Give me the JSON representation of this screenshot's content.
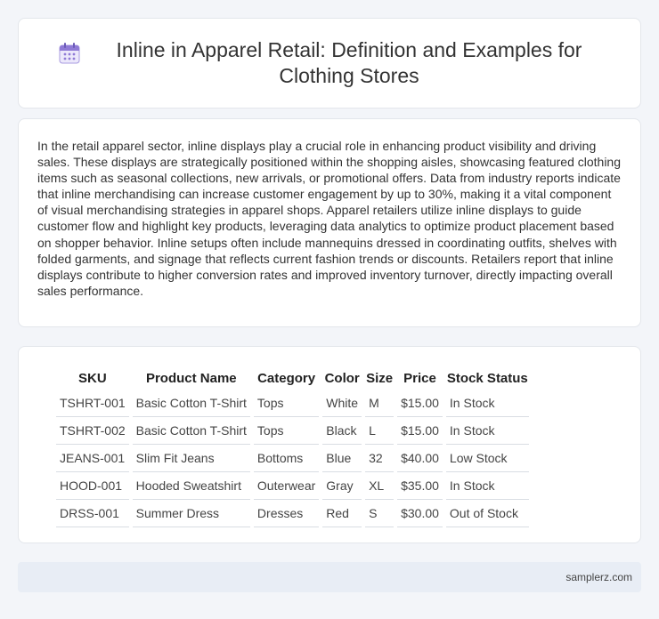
{
  "header": {
    "icon": "calendar-icon",
    "title": "Inline in Apparel Retail: Definition and Examples for Clothing Stores"
  },
  "body": {
    "paragraph": "In the retail apparel sector, inline displays play a crucial role in enhancing product visibility and driving sales. These displays are strategically positioned within the shopping aisles, showcasing featured clothing items such as seasonal collections, new arrivals, or promotional offers. Data from industry reports indicate that inline merchandising can increase customer engagement by up to 30%, making it a vital component of visual merchandising strategies in apparel shops. Apparel retailers utilize inline displays to guide customer flow and highlight key products, leveraging data analytics to optimize product placement based on shopper behavior. Inline setups often include mannequins dressed in coordinating outfits, shelves with folded garments, and signage that reflects current fashion trends or discounts. Retailers report that inline displays contribute to higher conversion rates and improved inventory turnover, directly impacting overall sales performance."
  },
  "table": {
    "headers": [
      "SKU",
      "Product Name",
      "Category",
      "Color",
      "Size",
      "Price",
      "Stock Status"
    ],
    "rows": [
      [
        "TSHRT-001",
        "Basic Cotton T-Shirt",
        "Tops",
        "White",
        "M",
        "$15.00",
        "In Stock"
      ],
      [
        "TSHRT-002",
        "Basic Cotton T-Shirt",
        "Tops",
        "Black",
        "L",
        "$15.00",
        "In Stock"
      ],
      [
        "JEANS-001",
        "Slim Fit Jeans",
        "Bottoms",
        "Blue",
        "32",
        "$40.00",
        "Low Stock"
      ],
      [
        "HOOD-001",
        "Hooded Sweatshirt",
        "Outerwear",
        "Gray",
        "XL",
        "$35.00",
        "In Stock"
      ],
      [
        "DRSS-001",
        "Summer Dress",
        "Dresses",
        "Red",
        "S",
        "$30.00",
        "Out of Stock"
      ]
    ]
  },
  "footer": {
    "site": "samplerz.com"
  },
  "colors": {
    "background": "#f3f5f9",
    "card": "#ffffff",
    "footer": "#e8edf5",
    "icon_accent": "#8f7ad6"
  }
}
